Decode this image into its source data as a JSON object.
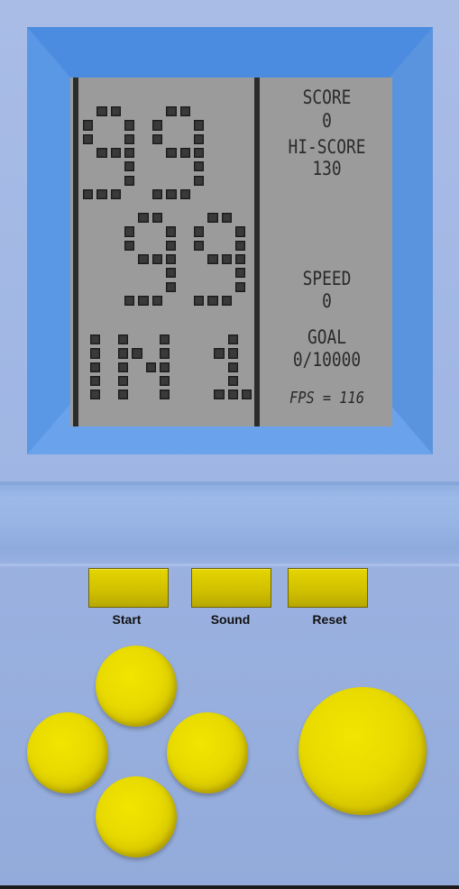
{
  "screen": {
    "title_rows": [
      "99",
      "99",
      "IN 1"
    ],
    "score_label": "SCORE",
    "score_value": "0",
    "hiscore_label": "HI-SCORE",
    "hiscore_value": "130",
    "speed_label": "SPEED",
    "speed_value": "0",
    "goal_label": "GOAL",
    "goal_value": "0/10000",
    "fps_text": "FPS = 116"
  },
  "controls": {
    "start_label": "Start",
    "sound_label": "Sound",
    "reset_label": "Reset"
  },
  "colors": {
    "body": "#9cb3e2",
    "frame": "#5d97e2",
    "lcd": "#9b9b9b",
    "button_yellow": "#e8da00"
  },
  "icons": [
    "dpad-up",
    "dpad-left",
    "dpad-right",
    "dpad-down",
    "action-button"
  ]
}
